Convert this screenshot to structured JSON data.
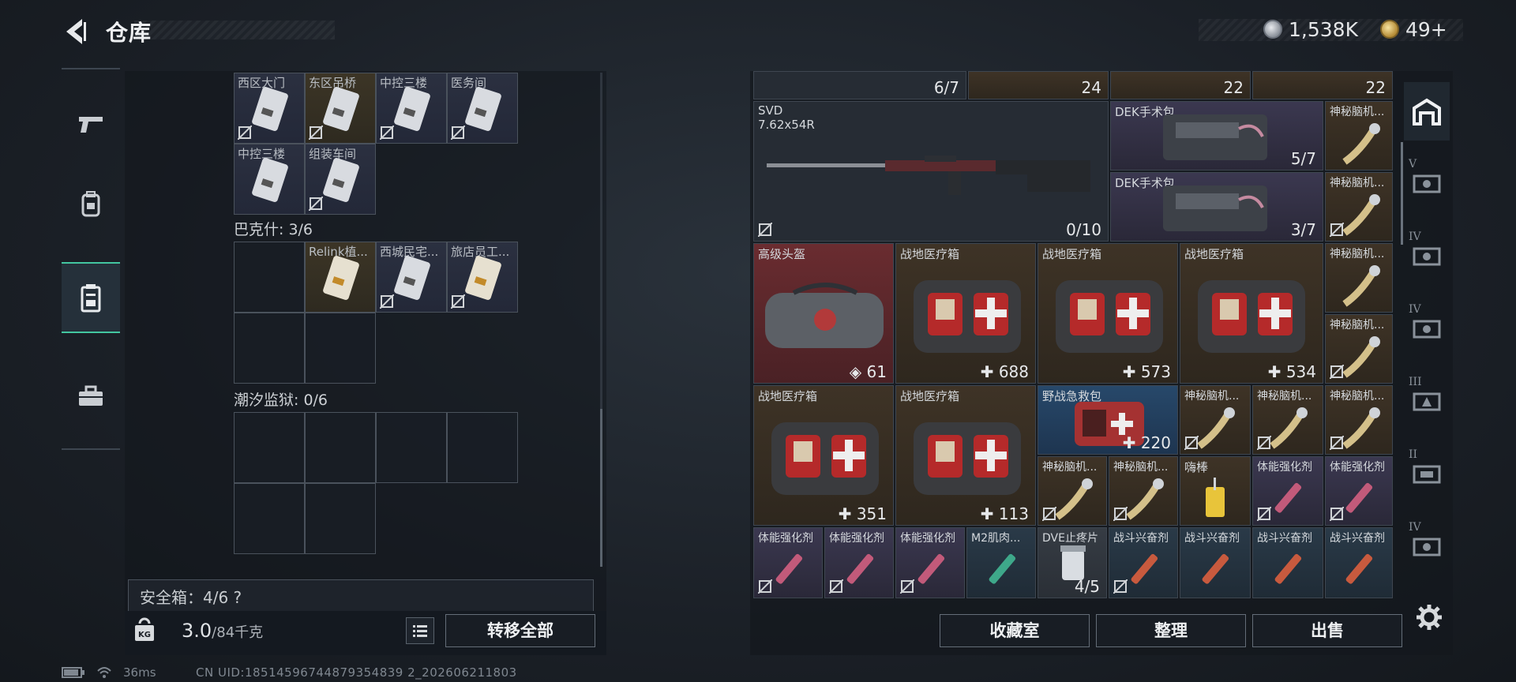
{
  "header": {
    "title": "仓库"
  },
  "currency": {
    "silver": "1,538K",
    "gold": "49+"
  },
  "left_nav": [
    {
      "name": "weapons"
    },
    {
      "name": "backpack"
    },
    {
      "name": "container"
    },
    {
      "name": "toolbox"
    }
  ],
  "left_panel": {
    "group1_row1": [
      "西区大门",
      "东区吊桥",
      "中控三楼",
      "医务间"
    ],
    "group1_row2": [
      "中控三楼",
      "组装车间"
    ],
    "baketsi_label": "巴克什: 3/6",
    "baketsi_items": [
      "Relink植...",
      "西城民宅...",
      "旅店员工..."
    ],
    "chaoxi_label": "潮汐监狱: 0/6",
    "safebox": "安全箱：4/6  ?",
    "weight_current": "3.0",
    "weight_max": "/84千克",
    "transfer_all": "转移全部"
  },
  "right_panel": {
    "top_row": [
      {
        "count": "6/7"
      },
      {
        "count": "24"
      },
      {
        "count": "22"
      },
      {
        "count": "22"
      }
    ],
    "svd": {
      "name": "SVD",
      "caliber": "7.62x54R",
      "count": "0/10"
    },
    "dek1": {
      "name": "DEK手术包",
      "count": "5/7"
    },
    "dek2": {
      "name": "DEK手术包",
      "count": "3/7"
    },
    "helmet": {
      "name": "高级头盔",
      "count": "61"
    },
    "medkits_row1": [
      {
        "name": "战地医疗箱",
        "count": "688"
      },
      {
        "name": "战地医疗箱",
        "count": "573"
      },
      {
        "name": "战地医疗箱",
        "count": "534"
      }
    ],
    "medkits_row2": [
      {
        "name": "战地医疗箱",
        "count": "351"
      },
      {
        "name": "战地医疗箱",
        "count": "113"
      }
    ],
    "field_aid": {
      "name": "野战急救包",
      "count": "220"
    },
    "brain": "神秘脑机...",
    "stick": "嗨棒",
    "stamina": "体能强化剂",
    "m2": "M2肌肉...",
    "dve": {
      "name": "DVE止疼片",
      "count": "4/5"
    },
    "combat": "战斗兴奋剂"
  },
  "right_nav": [
    {
      "label": ""
    },
    {
      "label": "V"
    },
    {
      "label": "IV"
    },
    {
      "label": "IV"
    },
    {
      "label": "III"
    },
    {
      "label": "II"
    },
    {
      "label": "IV"
    }
  ],
  "buttons": {
    "collection": "收藏室",
    "organize": "整理",
    "sell": "出售"
  },
  "status": {
    "ping": "36ms",
    "uid": "CN UID:18514596744879354839 2_202606211803"
  }
}
